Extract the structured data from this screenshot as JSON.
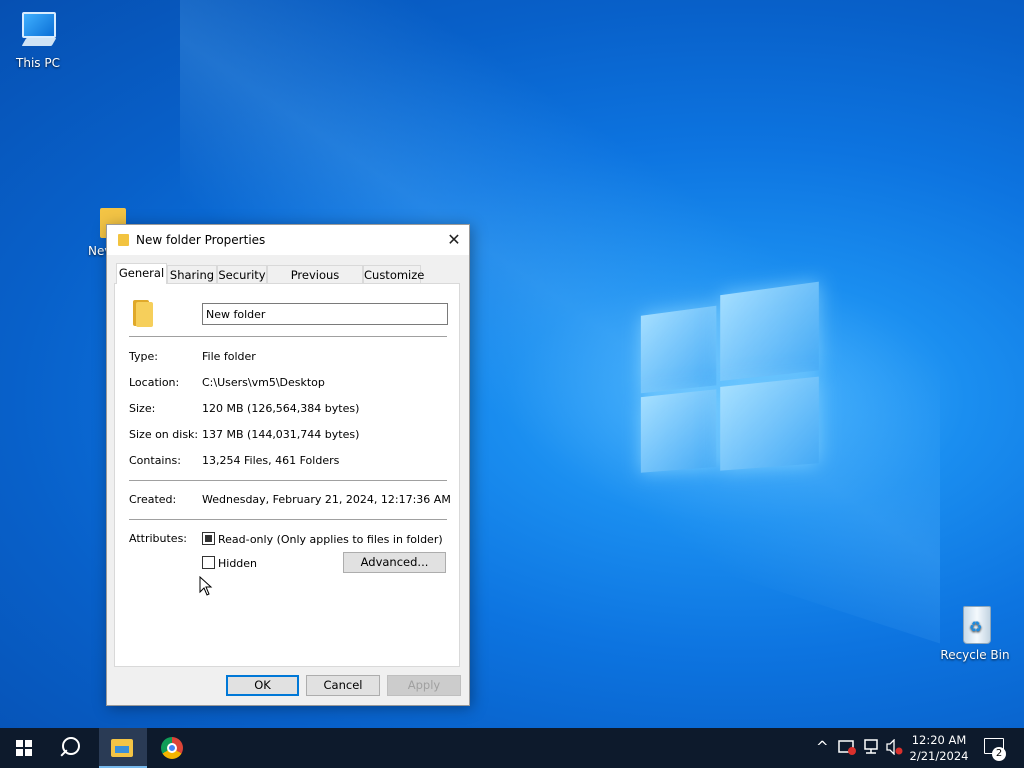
{
  "desktop": {
    "icons": [
      {
        "label": "This PC"
      },
      {
        "label": "Nev"
      },
      {
        "label": "Recycle Bin"
      }
    ]
  },
  "dialog": {
    "title": "New folder Properties",
    "close_glyph": "✕",
    "tabs": [
      "General",
      "Sharing",
      "Security",
      "Previous Versions",
      "Customize"
    ],
    "active_tab": "General",
    "name_value": "New folder",
    "info": [
      {
        "label": "Type:",
        "value": "File folder"
      },
      {
        "label": "Location:",
        "value": "C:\\Users\\vm5\\Desktop"
      },
      {
        "label": "Size:",
        "value": "120 MB (126,564,384 bytes)"
      },
      {
        "label": "Size on disk:",
        "value": "137 MB (144,031,744 bytes)"
      },
      {
        "label": "Contains:",
        "value": "13,254 Files, 461 Folders"
      }
    ],
    "created_label": "Created:",
    "created_value": "Wednesday, February 21, 2024, 12:17:36 AM",
    "attributes_label": "Attributes:",
    "readonly_label": "Read-only (Only applies to files in folder)",
    "readonly_state": "indeterminate",
    "hidden_label": "Hidden",
    "hidden_checked": false,
    "advanced_button": "Advanced...",
    "ok_button": "OK",
    "cancel_button": "Cancel",
    "apply_button": "Apply"
  },
  "taskbar": {
    "apps": [
      "start-icon",
      "search-icon",
      "file-explorer-icon",
      "chrome-icon"
    ],
    "tray_icons": [
      "chevron-up-icon",
      "security-icon",
      "network-icon",
      "volume-muted-icon"
    ],
    "time": "12:20 AM",
    "date": "2/21/2024",
    "notification_count": "2"
  }
}
